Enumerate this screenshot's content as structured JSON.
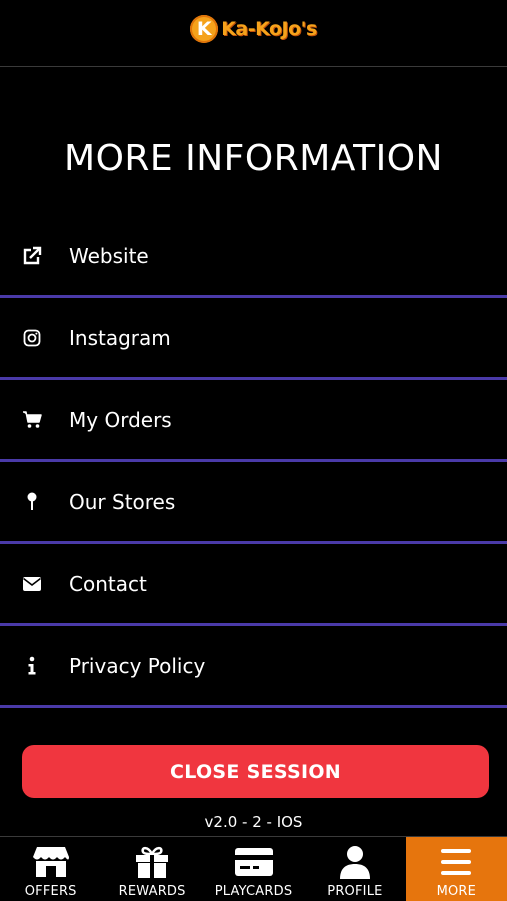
{
  "header": {
    "logo_letter": "K",
    "logo_text": "Ka-KoJo's"
  },
  "page": {
    "title": "MORE INFORMATION"
  },
  "menu": {
    "items": [
      {
        "label": "Website",
        "icon": "external-link-icon"
      },
      {
        "label": "Instagram",
        "icon": "instagram-icon"
      },
      {
        "label": "My Orders",
        "icon": "cart-icon"
      },
      {
        "label": "Our Stores",
        "icon": "map-pin-icon"
      },
      {
        "label": "Contact",
        "icon": "envelope-icon"
      },
      {
        "label": "Privacy Policy",
        "icon": "info-icon"
      }
    ]
  },
  "actions": {
    "close_session_label": "CLOSE SESSION"
  },
  "footer": {
    "version": "v2.0 - 2 - IOS"
  },
  "tabbar": {
    "tabs": [
      {
        "label": "OFFERS",
        "icon": "store-icon",
        "active": false
      },
      {
        "label": "REWARDS",
        "icon": "gift-icon",
        "active": false
      },
      {
        "label": "PLAYCARDS",
        "icon": "credit-card-icon",
        "active": false
      },
      {
        "label": "PROFILE",
        "icon": "user-icon",
        "active": false
      },
      {
        "label": "MORE",
        "icon": "menu-icon",
        "active": true
      }
    ]
  },
  "colors": {
    "background": "#000000",
    "divider": "#4a3aa8",
    "close_button": "#f0363f",
    "active_tab": "#e6750d",
    "logo": "#f5a21b"
  }
}
